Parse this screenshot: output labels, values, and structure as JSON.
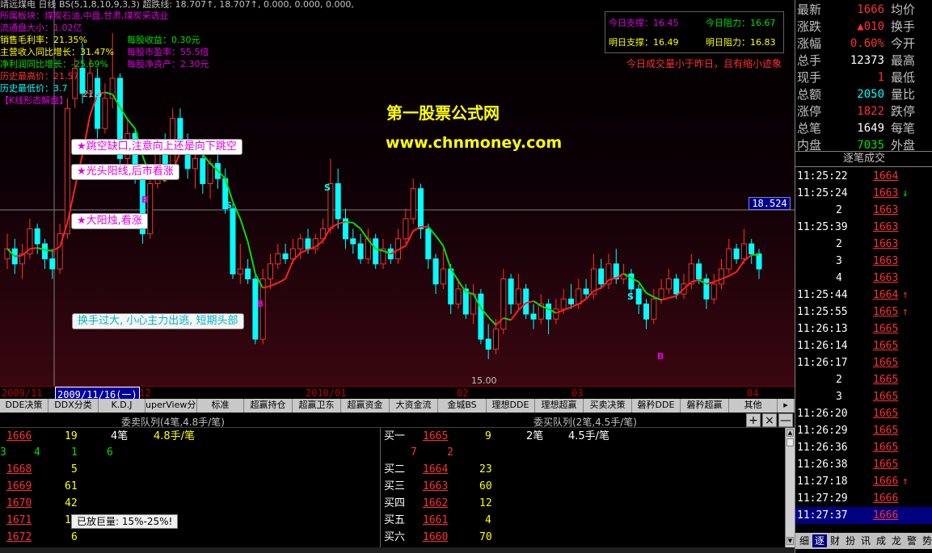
{
  "header": {
    "title_line": "靖远煤电 日线 BS(5,1,8,10,9,3,3) 超跌线: 18.707↑, 18.707↑, 0.000, 0.000, 0.000,",
    "sector": "所属板块：煤炭石油,中盘,甘肃,煤炭采选业",
    "float_cap": "流通盘大小：1.02亿",
    "gross_margin": "销售毛利率：21.35%",
    "eps": "每股收益：0.30元",
    "rev_growth": "主营收入同比增长：31.47%",
    "pe": "每股市盈率：55.5倍",
    "profit_growth": "净利润同比增长：-25.69%",
    "nav": "每股净资产：2.30元",
    "hist_high": "历史最高价：21.57",
    "hist_low": "历史最低价：3.7",
    "kline_tag": "【K线形态解盘】"
  },
  "support_box": {
    "today_support": "今日支撑：16.45",
    "today_resist": "今日阻力：16.67",
    "tom_support": "明日支撑：16.49",
    "tom_resist": "明日阻力：16.83",
    "volume_note": "今日成交量小于昨日，且有缩小迹象"
  },
  "watermark": {
    "site_name": "第一股票公式网",
    "site_url": "www.chnmoney.com"
  },
  "chart_labels": {
    "peak_price": "21.5",
    "low_price": "15.00",
    "cursor_price": "18.524",
    "signal_s": "S",
    "signal_b": "B"
  },
  "callouts": {
    "gap": "★跳空缺口,注意向上还是向下跳空",
    "bald_yang": "★光头阳线,后市看涨",
    "big_yang": "★大阳烛,看涨",
    "turnover": "换手过大, 小心主力出逃, 短期头部",
    "big_volume": "已放巨量: 15%-25%!"
  },
  "time_axis": {
    "labels": [
      "2009/11",
      "2009/11/16(一)",
      "12",
      "2010/01",
      "02",
      "03",
      "04"
    ]
  },
  "tabs": [
    "DDE决策",
    "DDX分类",
    "K.D.J",
    "uperView分析",
    "标准",
    "超赢持仓",
    "超赢卫东",
    "超赢资金",
    "大资金流",
    "金城BS",
    "理想DDE",
    "理想超赢",
    "买卖决策",
    "磐矜DDE",
    "磐矜超赢",
    "其他"
  ],
  "queue": {
    "sell_title": "委卖队列(4笔,4.8手/笔)",
    "buy_title": "委买队列(2笔,4.5手/笔)",
    "plus": "+",
    "close": "×",
    "minus": "—",
    "sell_summary": {
      "price": "1666",
      "volume": "19",
      "count": "4笔",
      "avg": "4.8手/笔"
    },
    "sell_detail": [
      "3",
      "4",
      "1",
      "6"
    ],
    "sell_rows": [
      {
        "price": "1668",
        "volume": "5"
      },
      {
        "price": "1669",
        "volume": "61"
      },
      {
        "price": "1670",
        "volume": "42"
      },
      {
        "price": "1671",
        "volume": "1"
      },
      {
        "price": "1672",
        "volume": "6"
      }
    ],
    "buy_summary": {
      "label": "买一",
      "price": "1665",
      "volume": "9",
      "count": "2笔",
      "avg": "4.5手/笔"
    },
    "buy_detail": [
      "7",
      "2"
    ],
    "buy_rows": [
      {
        "label": "买二",
        "price": "1664",
        "volume": "23"
      },
      {
        "label": "买三",
        "price": "1663",
        "volume": "60"
      },
      {
        "label": "买四",
        "price": "1662",
        "volume": "12"
      },
      {
        "label": "买五",
        "price": "1661",
        "volume": "4"
      },
      {
        "label": "买六",
        "price": "1660",
        "volume": "70"
      }
    ]
  },
  "quote": {
    "rows": [
      {
        "l1": "最新",
        "v": "1666",
        "l2": "均价",
        "c": "red"
      },
      {
        "l1": "涨跌",
        "v": "▲010",
        "l2": "换手",
        "c": "red"
      },
      {
        "l1": "涨幅",
        "v": "0.60%",
        "l2": "今开",
        "c": "red"
      },
      {
        "l1": "总手",
        "v": "12373",
        "l2": "最高",
        "c": "wht"
      },
      {
        "l1": "现手",
        "v": "1",
        "l2": "最低",
        "c": "red"
      },
      {
        "l1": "总额",
        "v": "2050",
        "l2": "量比",
        "c": "cy"
      },
      {
        "l1": "涨停",
        "v": "1822",
        "l2": "跌停",
        "c": "red"
      },
      {
        "l1": "总笔",
        "v": "1649",
        "l2": "每笔",
        "c": "wht"
      },
      {
        "l1": "内盘",
        "v": "7035",
        "l2": "外盘",
        "c": "grn"
      }
    ],
    "ticks_title": "逐笔成交",
    "ticks": [
      {
        "t": "11:25:22",
        "p": "1664",
        "a": ""
      },
      {
        "t": "11:25:24",
        "p": "1663",
        "a": "↓"
      },
      {
        "t": "2",
        "p": "1663",
        "a": ""
      },
      {
        "t": "11:25:39",
        "p": "1663",
        "a": ""
      },
      {
        "t": "2",
        "p": "1663",
        "a": ""
      },
      {
        "t": "3",
        "p": "1663",
        "a": ""
      },
      {
        "t": "4",
        "p": "1663",
        "a": ""
      },
      {
        "t": "11:25:44",
        "p": "1664",
        "a": "↑"
      },
      {
        "t": "11:25:55",
        "p": "1665",
        "a": "↑"
      },
      {
        "t": "11:26:13",
        "p": "1665",
        "a": ""
      },
      {
        "t": "11:26:14",
        "p": "1665",
        "a": ""
      },
      {
        "t": "11:26:17",
        "p": "1665",
        "a": ""
      },
      {
        "t": "2",
        "p": "1665",
        "a": ""
      },
      {
        "t": "3",
        "p": "1665",
        "a": ""
      },
      {
        "t": "11:26:20",
        "p": "1665",
        "a": ""
      },
      {
        "t": "11:26:29",
        "p": "1665",
        "a": ""
      },
      {
        "t": "11:26:36",
        "p": "1665",
        "a": ""
      },
      {
        "t": "11:26:38",
        "p": "1665",
        "a": ""
      },
      {
        "t": "11:27:18",
        "p": "1666",
        "a": "↑"
      },
      {
        "t": "11:27:29",
        "p": "1666",
        "a": ""
      },
      {
        "t": "11:27:37",
        "p": "1666",
        "a": ""
      }
    ],
    "bottom_tabs": [
      "细",
      "逐",
      "财",
      "扮",
      "讯",
      "成",
      "龙",
      "警",
      "势"
    ]
  },
  "colors": {
    "up": "#ff3030",
    "down": "#00ffff",
    "ma_green": "#00e000",
    "ma_red": "#ff2020",
    "highlight_row": "#000080"
  },
  "candles": [
    {
      "o": 17.0,
      "c": 17.2,
      "h": 17.5,
      "l": 16.8
    },
    {
      "o": 17.2,
      "c": 16.9,
      "h": 17.4,
      "l": 16.7
    },
    {
      "o": 16.9,
      "c": 17.1,
      "h": 17.3,
      "l": 16.6
    },
    {
      "o": 17.1,
      "c": 17.6,
      "h": 17.8,
      "l": 17.0
    },
    {
      "o": 17.6,
      "c": 17.3,
      "h": 17.7,
      "l": 17.1
    },
    {
      "o": 17.3,
      "c": 17.0,
      "h": 17.4,
      "l": 16.8
    },
    {
      "o": 17.0,
      "c": 16.8,
      "h": 17.2,
      "l": 16.6
    },
    {
      "o": 16.8,
      "c": 17.5,
      "h": 17.7,
      "l": 16.7
    },
    {
      "o": 17.5,
      "c": 20.0,
      "h": 20.2,
      "l": 17.4
    },
    {
      "o": 20.2,
      "c": 20.8,
      "h": 21.0,
      "l": 20.0
    },
    {
      "o": 20.8,
      "c": 20.3,
      "h": 21.3,
      "l": 20.1
    },
    {
      "o": 20.3,
      "c": 20.7,
      "h": 21.0,
      "l": 20.2
    },
    {
      "o": 20.6,
      "c": 19.6,
      "h": 20.8,
      "l": 19.4
    },
    {
      "o": 19.6,
      "c": 20.2,
      "h": 20.5,
      "l": 19.5
    },
    {
      "o": 20.2,
      "c": 20.6,
      "h": 21.5,
      "l": 20.0
    },
    {
      "o": 20.6,
      "c": 19.0,
      "h": 20.7,
      "l": 18.9
    },
    {
      "o": 19.0,
      "c": 19.5,
      "h": 19.8,
      "l": 18.8
    },
    {
      "o": 19.5,
      "c": 18.7,
      "h": 19.6,
      "l": 18.5
    },
    {
      "o": 18.7,
      "c": 17.5,
      "h": 18.9,
      "l": 17.3
    },
    {
      "o": 17.5,
      "c": 18.5,
      "h": 18.7,
      "l": 17.4
    },
    {
      "o": 18.5,
      "c": 19.2,
      "h": 19.4,
      "l": 18.4
    },
    {
      "o": 19.2,
      "c": 18.8,
      "h": 19.5,
      "l": 18.6
    },
    {
      "o": 18.8,
      "c": 19.8,
      "h": 20.0,
      "l": 18.7
    },
    {
      "o": 19.8,
      "c": 19.3,
      "h": 20.0,
      "l": 19.1
    },
    {
      "o": 19.3,
      "c": 18.8,
      "h": 19.5,
      "l": 18.6
    },
    {
      "o": 18.8,
      "c": 19.0,
      "h": 19.3,
      "l": 18.4
    },
    {
      "o": 19.0,
      "c": 18.5,
      "h": 19.2,
      "l": 18.3
    },
    {
      "o": 18.5,
      "c": 18.9,
      "h": 19.0,
      "l": 18.2
    },
    {
      "o": 18.9,
      "c": 18.6,
      "h": 19.1,
      "l": 18.4
    },
    {
      "o": 18.6,
      "c": 18.0,
      "h": 18.8,
      "l": 17.9
    },
    {
      "o": 18.0,
      "c": 16.7,
      "h": 18.1,
      "l": 16.6
    },
    {
      "o": 16.7,
      "c": 16.8,
      "h": 17.3,
      "l": 16.5
    },
    {
      "o": 16.8,
      "c": 16.6,
      "h": 17.0,
      "l": 16.5
    },
    {
      "o": 16.6,
      "c": 15.4,
      "h": 16.7,
      "l": 15.3
    },
    {
      "o": 15.4,
      "c": 16.6,
      "h": 16.8,
      "l": 15.3
    },
    {
      "o": 16.6,
      "c": 16.9,
      "h": 17.1,
      "l": 16.4
    },
    {
      "o": 16.9,
      "c": 17.1,
      "h": 17.3,
      "l": 16.8
    },
    {
      "o": 17.1,
      "c": 17.0,
      "h": 17.3,
      "l": 16.9
    },
    {
      "o": 17.0,
      "c": 17.2,
      "h": 17.4,
      "l": 16.9
    },
    {
      "o": 17.2,
      "c": 17.4,
      "h": 17.5,
      "l": 17.0
    },
    {
      "o": 17.4,
      "c": 17.2,
      "h": 17.6,
      "l": 17.1
    },
    {
      "o": 17.2,
      "c": 17.4,
      "h": 17.5,
      "l": 17.1
    },
    {
      "o": 17.4,
      "c": 17.6,
      "h": 17.8,
      "l": 17.3
    },
    {
      "o": 17.6,
      "c": 18.5,
      "h": 19.0,
      "l": 17.5
    },
    {
      "o": 18.5,
      "c": 17.8,
      "h": 18.8,
      "l": 17.6
    },
    {
      "o": 17.8,
      "c": 17.4,
      "h": 18.0,
      "l": 17.2
    },
    {
      "o": 17.4,
      "c": 17.3,
      "h": 17.6,
      "l": 17.1
    },
    {
      "o": 17.3,
      "c": 17.0,
      "h": 17.5,
      "l": 16.9
    },
    {
      "o": 17.0,
      "c": 17.4,
      "h": 17.6,
      "l": 16.9
    },
    {
      "o": 17.4,
      "c": 16.9,
      "h": 17.5,
      "l": 16.8
    },
    {
      "o": 16.9,
      "c": 17.2,
      "h": 17.4,
      "l": 16.8
    },
    {
      "o": 17.2,
      "c": 17.0,
      "h": 17.3,
      "l": 16.9
    },
    {
      "o": 17.0,
      "c": 17.4,
      "h": 17.6,
      "l": 16.9
    },
    {
      "o": 17.4,
      "c": 17.8,
      "h": 18.0,
      "l": 17.3
    },
    {
      "o": 17.8,
      "c": 18.4,
      "h": 18.6,
      "l": 17.7
    },
    {
      "o": 18.4,
      "c": 17.6,
      "h": 18.5,
      "l": 17.4
    },
    {
      "o": 17.6,
      "c": 17.0,
      "h": 17.7,
      "l": 16.8
    },
    {
      "o": 17.0,
      "c": 16.5,
      "h": 17.1,
      "l": 16.3
    },
    {
      "o": 16.5,
      "c": 16.8,
      "h": 17.2,
      "l": 16.4
    },
    {
      "o": 16.8,
      "c": 16.1,
      "h": 16.9,
      "l": 15.9
    },
    {
      "o": 16.1,
      "c": 16.4,
      "h": 16.6,
      "l": 16.0
    },
    {
      "o": 16.4,
      "c": 15.9,
      "h": 16.5,
      "l": 15.8
    },
    {
      "o": 15.9,
      "c": 16.3,
      "h": 16.5,
      "l": 15.7
    },
    {
      "o": 16.3,
      "c": 15.4,
      "h": 16.4,
      "l": 15.3
    },
    {
      "o": 15.4,
      "c": 15.2,
      "h": 15.7,
      "l": 15.0
    },
    {
      "o": 15.2,
      "c": 15.6,
      "h": 15.8,
      "l": 15.1
    },
    {
      "o": 15.6,
      "c": 16.6,
      "h": 16.8,
      "l": 15.5
    },
    {
      "o": 16.6,
      "c": 16.1,
      "h": 16.7,
      "l": 15.9
    },
    {
      "o": 16.1,
      "c": 16.4,
      "h": 16.7,
      "l": 16.0
    },
    {
      "o": 16.4,
      "c": 15.9,
      "h": 16.5,
      "l": 15.8
    },
    {
      "o": 15.9,
      "c": 15.8,
      "h": 16.1,
      "l": 15.6
    },
    {
      "o": 15.8,
      "c": 16.1,
      "h": 16.3,
      "l": 15.7
    },
    {
      "o": 16.1,
      "c": 15.8,
      "h": 16.2,
      "l": 15.5
    },
    {
      "o": 15.8,
      "c": 16.0,
      "h": 16.2,
      "l": 15.7
    },
    {
      "o": 16.0,
      "c": 16.2,
      "h": 16.4,
      "l": 15.9
    },
    {
      "o": 16.2,
      "c": 16.1,
      "h": 16.5,
      "l": 16.0
    },
    {
      "o": 16.1,
      "c": 16.4,
      "h": 16.6,
      "l": 16.0
    },
    {
      "o": 16.4,
      "c": 16.3,
      "h": 16.6,
      "l": 16.2
    },
    {
      "o": 16.3,
      "c": 16.8,
      "h": 17.1,
      "l": 16.2
    },
    {
      "o": 16.8,
      "c": 16.5,
      "h": 17.0,
      "l": 16.4
    },
    {
      "o": 16.5,
      "c": 16.9,
      "h": 17.1,
      "l": 16.4
    },
    {
      "o": 16.9,
      "c": 16.6,
      "h": 17.2,
      "l": 16.5
    },
    {
      "o": 16.6,
      "c": 16.7,
      "h": 16.9,
      "l": 16.5
    },
    {
      "o": 16.7,
      "c": 16.4,
      "h": 16.8,
      "l": 16.2
    },
    {
      "o": 16.4,
      "c": 16.1,
      "h": 16.5,
      "l": 15.9
    },
    {
      "o": 16.1,
      "c": 15.8,
      "h": 16.2,
      "l": 15.6
    },
    {
      "o": 15.8,
      "c": 16.2,
      "h": 16.4,
      "l": 15.7
    },
    {
      "o": 16.2,
      "c": 16.4,
      "h": 16.6,
      "l": 16.1
    },
    {
      "o": 16.4,
      "c": 16.6,
      "h": 16.8,
      "l": 16.3
    },
    {
      "o": 16.6,
      "c": 16.3,
      "h": 16.7,
      "l": 16.2
    },
    {
      "o": 16.3,
      "c": 16.5,
      "h": 16.7,
      "l": 16.2
    },
    {
      "o": 16.5,
      "c": 16.9,
      "h": 17.1,
      "l": 16.4
    },
    {
      "o": 16.9,
      "c": 16.6,
      "h": 17.0,
      "l": 16.5
    },
    {
      "o": 16.6,
      "c": 16.2,
      "h": 16.7,
      "l": 16.0
    },
    {
      "o": 16.2,
      "c": 16.5,
      "h": 16.7,
      "l": 16.1
    },
    {
      "o": 16.5,
      "c": 16.8,
      "h": 17.0,
      "l": 16.4
    },
    {
      "o": 16.8,
      "c": 17.2,
      "h": 17.4,
      "l": 16.7
    },
    {
      "o": 17.2,
      "c": 17.0,
      "h": 17.3,
      "l": 16.9
    },
    {
      "o": 17.0,
      "c": 17.3,
      "h": 17.6,
      "l": 16.9
    },
    {
      "o": 17.3,
      "c": 17.1,
      "h": 17.4,
      "l": 16.9
    },
    {
      "o": 17.1,
      "c": 16.8,
      "h": 17.2,
      "l": 16.6
    }
  ]
}
